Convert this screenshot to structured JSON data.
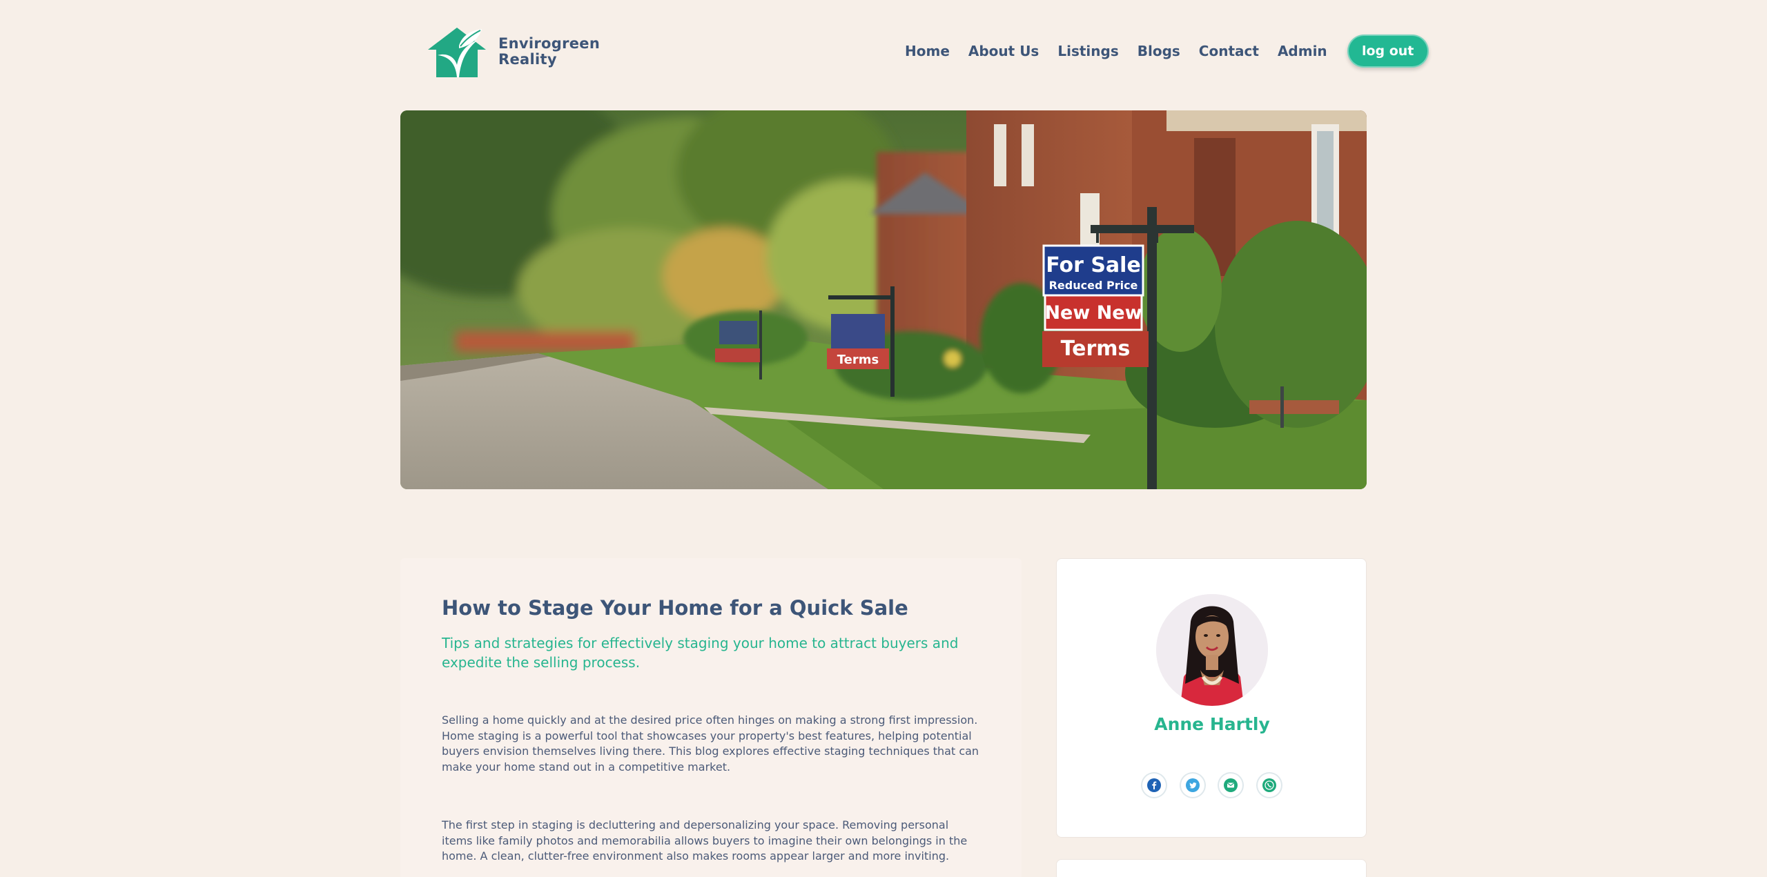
{
  "brand": {
    "name_line1": "Envirogreen",
    "name_line2": "Reality",
    "logo_icon": "house-leaf-icon",
    "color_primary": "#22b893",
    "color_text": "#3d5578"
  },
  "nav": {
    "items": [
      "Home",
      "About Us",
      "Listings",
      "Blogs",
      "Contact",
      "Admin"
    ],
    "logout_label": "log out"
  },
  "hero": {
    "sign_line1": "For Sale",
    "sign_line2": "Reduced Price",
    "sign_line3": "New New",
    "sign_line4": "Terms",
    "small_sign": "Terms"
  },
  "article": {
    "title": "How to Stage Your Home for a Quick Sale",
    "subtitle": "Tips and strategies for effectively staging your home to attract buyers and expedite the selling process.",
    "paragraphs": [
      "Selling a home quickly and at the desired price often hinges on making a strong first impression. Home staging is a powerful tool that showcases your property's best features, helping potential buyers envision themselves living there. This blog explores effective staging techniques that can make your home stand out in a competitive market.",
      "The first step in staging is decluttering and depersonalizing your space. Removing personal items like family photos and memorabilia allows buyers to imagine their own belongings in the home. A clean, clutter-free environment also makes rooms appear larger and more inviting."
    ]
  },
  "author": {
    "name": "Anne Hartly",
    "socials": [
      {
        "icon": "facebook-icon",
        "color": "#1f63b5"
      },
      {
        "icon": "twitter-icon",
        "color": "#3da6e0"
      },
      {
        "icon": "email-icon",
        "color": "#1faa7c"
      },
      {
        "icon": "phone-icon",
        "color": "#1faa7c"
      }
    ]
  }
}
